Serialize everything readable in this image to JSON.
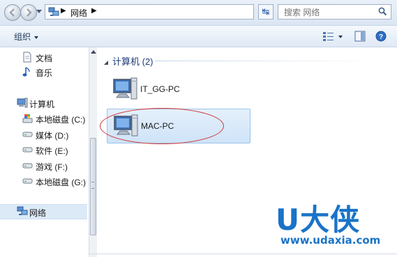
{
  "address_bar": {
    "breadcrumb": [
      "网络"
    ],
    "search_placeholder": "搜索 网络"
  },
  "toolbar": {
    "organize_label": "组织"
  },
  "nav_pane": {
    "items": [
      {
        "label": "文档",
        "icon": "document-icon"
      },
      {
        "label": "音乐",
        "icon": "music-icon"
      },
      {
        "label": "计算机",
        "icon": "computer-icon"
      },
      {
        "label": "本地磁盘 (C:)",
        "icon": "system-drive-icon"
      },
      {
        "label": "媒体 (D:)",
        "icon": "drive-icon"
      },
      {
        "label": "软件 (E:)",
        "icon": "drive-icon"
      },
      {
        "label": "游戏 (F:)",
        "icon": "drive-icon"
      },
      {
        "label": "本地磁盘 (G:)",
        "icon": "drive-icon"
      },
      {
        "label": "网络",
        "icon": "network-icon",
        "selected": true
      }
    ]
  },
  "content": {
    "group_title": "计算机 (2)",
    "computers": [
      {
        "name": "IT_GG-PC",
        "selected": false
      },
      {
        "name": "MAC-PC",
        "selected": true
      }
    ]
  },
  "watermark": {
    "logo": "U大侠",
    "url": "www.udaxia.com"
  },
  "colors": {
    "accent": "#1a73c8",
    "selection": "#cfe3f8",
    "highlight_oval": "#d23232"
  }
}
